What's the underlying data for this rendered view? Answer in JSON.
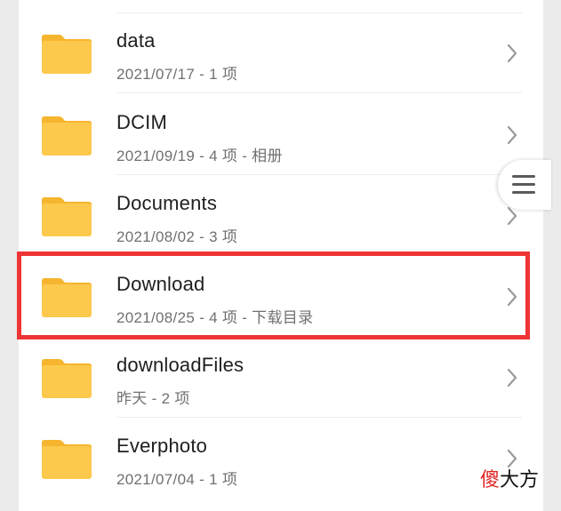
{
  "files": [
    {
      "name": "data",
      "meta": "2021/07/17 - 1 项"
    },
    {
      "name": "DCIM",
      "meta": "2021/09/19 - 4 项 - 相册"
    },
    {
      "name": "Documents",
      "meta": "2021/08/02 - 3 项"
    },
    {
      "name": "Download",
      "meta": "2021/08/25 - 4 项 - 下载目录"
    },
    {
      "name": "downloadFiles",
      "meta": "昨天 - 2 项"
    },
    {
      "name": "Everphoto",
      "meta": "2021/07/04 - 1 项"
    }
  ],
  "watermark": {
    "accent": "傻",
    "rest": "大方"
  },
  "colors": {
    "folder": "#fcc94d",
    "folder_tab": "#f6b52e",
    "highlight": "#ee3434"
  }
}
